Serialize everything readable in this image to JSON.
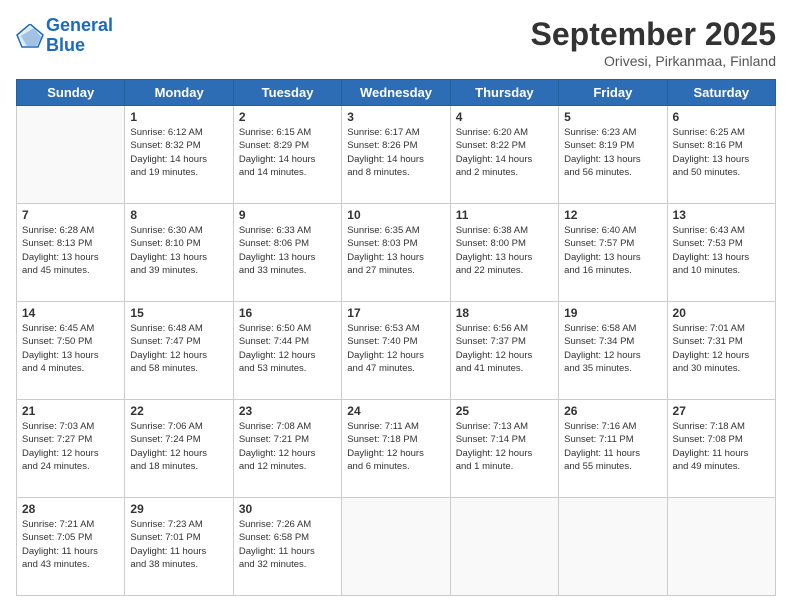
{
  "logo": {
    "line1": "General",
    "line2": "Blue"
  },
  "header": {
    "month": "September 2025",
    "location": "Orivesi, Pirkanmaa, Finland"
  },
  "weekdays": [
    "Sunday",
    "Monday",
    "Tuesday",
    "Wednesday",
    "Thursday",
    "Friday",
    "Saturday"
  ],
  "weeks": [
    [
      {
        "day": "",
        "info": ""
      },
      {
        "day": "1",
        "info": "Sunrise: 6:12 AM\nSunset: 8:32 PM\nDaylight: 14 hours\nand 19 minutes."
      },
      {
        "day": "2",
        "info": "Sunrise: 6:15 AM\nSunset: 8:29 PM\nDaylight: 14 hours\nand 14 minutes."
      },
      {
        "day": "3",
        "info": "Sunrise: 6:17 AM\nSunset: 8:26 PM\nDaylight: 14 hours\nand 8 minutes."
      },
      {
        "day": "4",
        "info": "Sunrise: 6:20 AM\nSunset: 8:22 PM\nDaylight: 14 hours\nand 2 minutes."
      },
      {
        "day": "5",
        "info": "Sunrise: 6:23 AM\nSunset: 8:19 PM\nDaylight: 13 hours\nand 56 minutes."
      },
      {
        "day": "6",
        "info": "Sunrise: 6:25 AM\nSunset: 8:16 PM\nDaylight: 13 hours\nand 50 minutes."
      }
    ],
    [
      {
        "day": "7",
        "info": "Sunrise: 6:28 AM\nSunset: 8:13 PM\nDaylight: 13 hours\nand 45 minutes."
      },
      {
        "day": "8",
        "info": "Sunrise: 6:30 AM\nSunset: 8:10 PM\nDaylight: 13 hours\nand 39 minutes."
      },
      {
        "day": "9",
        "info": "Sunrise: 6:33 AM\nSunset: 8:06 PM\nDaylight: 13 hours\nand 33 minutes."
      },
      {
        "day": "10",
        "info": "Sunrise: 6:35 AM\nSunset: 8:03 PM\nDaylight: 13 hours\nand 27 minutes."
      },
      {
        "day": "11",
        "info": "Sunrise: 6:38 AM\nSunset: 8:00 PM\nDaylight: 13 hours\nand 22 minutes."
      },
      {
        "day": "12",
        "info": "Sunrise: 6:40 AM\nSunset: 7:57 PM\nDaylight: 13 hours\nand 16 minutes."
      },
      {
        "day": "13",
        "info": "Sunrise: 6:43 AM\nSunset: 7:53 PM\nDaylight: 13 hours\nand 10 minutes."
      }
    ],
    [
      {
        "day": "14",
        "info": "Sunrise: 6:45 AM\nSunset: 7:50 PM\nDaylight: 13 hours\nand 4 minutes."
      },
      {
        "day": "15",
        "info": "Sunrise: 6:48 AM\nSunset: 7:47 PM\nDaylight: 12 hours\nand 58 minutes."
      },
      {
        "day": "16",
        "info": "Sunrise: 6:50 AM\nSunset: 7:44 PM\nDaylight: 12 hours\nand 53 minutes."
      },
      {
        "day": "17",
        "info": "Sunrise: 6:53 AM\nSunset: 7:40 PM\nDaylight: 12 hours\nand 47 minutes."
      },
      {
        "day": "18",
        "info": "Sunrise: 6:56 AM\nSunset: 7:37 PM\nDaylight: 12 hours\nand 41 minutes."
      },
      {
        "day": "19",
        "info": "Sunrise: 6:58 AM\nSunset: 7:34 PM\nDaylight: 12 hours\nand 35 minutes."
      },
      {
        "day": "20",
        "info": "Sunrise: 7:01 AM\nSunset: 7:31 PM\nDaylight: 12 hours\nand 30 minutes."
      }
    ],
    [
      {
        "day": "21",
        "info": "Sunrise: 7:03 AM\nSunset: 7:27 PM\nDaylight: 12 hours\nand 24 minutes."
      },
      {
        "day": "22",
        "info": "Sunrise: 7:06 AM\nSunset: 7:24 PM\nDaylight: 12 hours\nand 18 minutes."
      },
      {
        "day": "23",
        "info": "Sunrise: 7:08 AM\nSunset: 7:21 PM\nDaylight: 12 hours\nand 12 minutes."
      },
      {
        "day": "24",
        "info": "Sunrise: 7:11 AM\nSunset: 7:18 PM\nDaylight: 12 hours\nand 6 minutes."
      },
      {
        "day": "25",
        "info": "Sunrise: 7:13 AM\nSunset: 7:14 PM\nDaylight: 12 hours\nand 1 minute."
      },
      {
        "day": "26",
        "info": "Sunrise: 7:16 AM\nSunset: 7:11 PM\nDaylight: 11 hours\nand 55 minutes."
      },
      {
        "day": "27",
        "info": "Sunrise: 7:18 AM\nSunset: 7:08 PM\nDaylight: 11 hours\nand 49 minutes."
      }
    ],
    [
      {
        "day": "28",
        "info": "Sunrise: 7:21 AM\nSunset: 7:05 PM\nDaylight: 11 hours\nand 43 minutes."
      },
      {
        "day": "29",
        "info": "Sunrise: 7:23 AM\nSunset: 7:01 PM\nDaylight: 11 hours\nand 38 minutes."
      },
      {
        "day": "30",
        "info": "Sunrise: 7:26 AM\nSunset: 6:58 PM\nDaylight: 11 hours\nand 32 minutes."
      },
      {
        "day": "",
        "info": ""
      },
      {
        "day": "",
        "info": ""
      },
      {
        "day": "",
        "info": ""
      },
      {
        "day": "",
        "info": ""
      }
    ]
  ]
}
